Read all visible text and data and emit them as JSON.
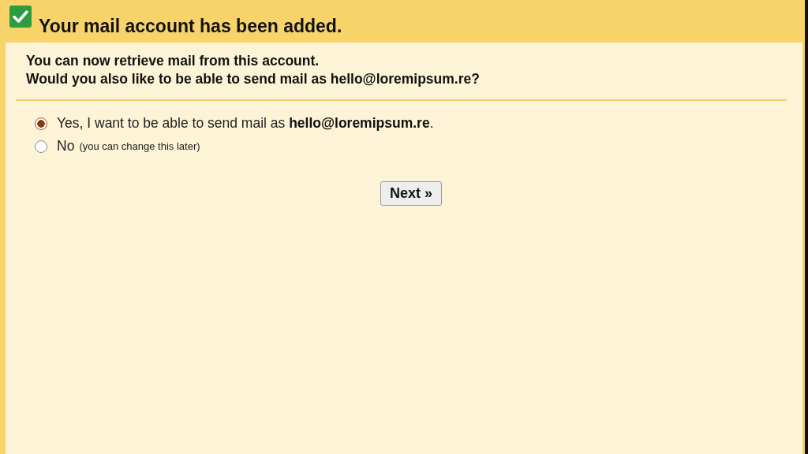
{
  "header": {
    "title": "Your mail account has been added."
  },
  "intro": [
    "You can now retrieve mail from this account.",
    "Would you also like to be able to send mail as hello@loremipsum.re?"
  ],
  "options": [
    {
      "label": "Yes, I want to be able to send mail as **hello@loremipsum.re**.",
      "selected": true
    },
    {
      "label": "No",
      "note": "(you can change this later)",
      "selected": false
    }
  ],
  "buttons": [
    {
      "label": "Next »"
    }
  ]
}
